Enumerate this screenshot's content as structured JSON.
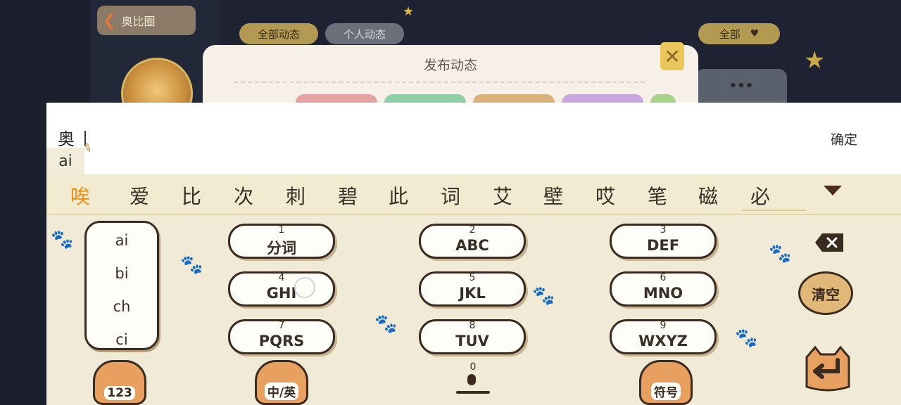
{
  "background": {
    "back_button_label": "奥比圈",
    "tabs": [
      {
        "label": "全部动态"
      },
      {
        "label": "个人动态"
      }
    ],
    "filter_label": "全部",
    "more_label": "•••"
  },
  "dialog": {
    "title": "发布动态",
    "tag_colors": [
      "#e5a3a3",
      "#8fcfa8",
      "#d8b27a",
      "#c6a6dc",
      "#a8d48a"
    ]
  },
  "ime": {
    "composed_text": "奥",
    "pinyin": "ai",
    "confirm_label": "确定",
    "candidates": [
      "唉",
      "爱",
      "比",
      "次",
      "刺",
      "碧",
      "此",
      "词",
      "艾",
      "壁",
      "哎",
      "笔",
      "磁",
      "必"
    ],
    "active_candidate_index": 0,
    "pinyin_list": [
      "ai",
      "bi",
      "ch",
      "ci"
    ],
    "keys": [
      {
        "num": "1",
        "label": "分词"
      },
      {
        "num": "2",
        "label": "ABC"
      },
      {
        "num": "3",
        "label": "DEF"
      },
      {
        "num": "4",
        "label": "GHI"
      },
      {
        "num": "5",
        "label": "JKL"
      },
      {
        "num": "6",
        "label": "MNO"
      },
      {
        "num": "7",
        "label": "PQRS"
      },
      {
        "num": "8",
        "label": "TUV"
      },
      {
        "num": "9",
        "label": "WXYZ"
      }
    ],
    "clear_label": "清空",
    "bottom": {
      "numeric_label": "123",
      "lang_label": "中/英",
      "space_num": "0",
      "symbol_label": "符号"
    }
  },
  "colors": {
    "active_candidate": "#f08c10",
    "keyboard_bg": "#f0ead6",
    "key_border": "#3a2a20"
  }
}
